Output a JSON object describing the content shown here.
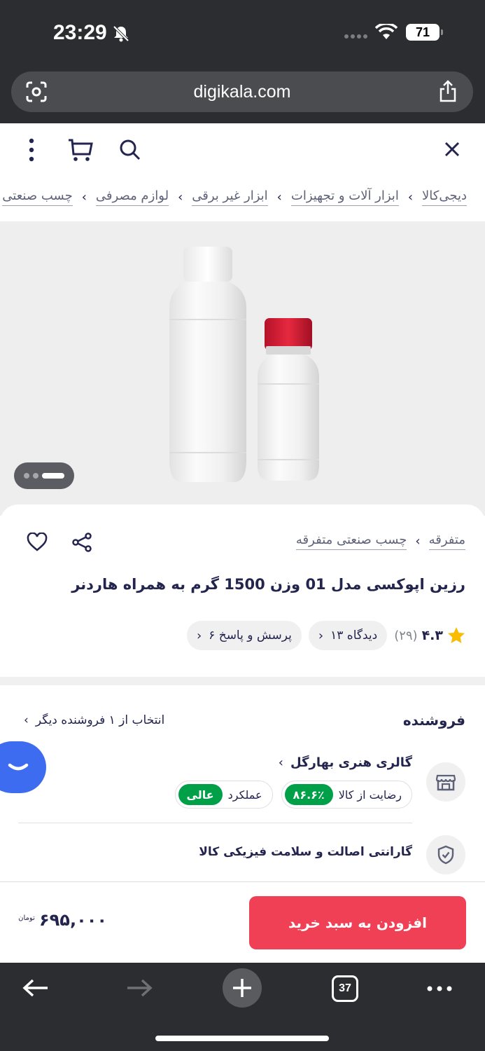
{
  "status": {
    "time": "23:29",
    "battery": "71"
  },
  "browser": {
    "url": "digikala.com",
    "tab_count": "37"
  },
  "breadcrumb": [
    "دیجی‌کالا",
    "ابزار آلات و تجهیزات",
    "ابزار غیر برقی",
    "لوازم مصرفی",
    "چسب صنعتی"
  ],
  "product": {
    "categories": [
      "متفرقه",
      "چسب صنعتی متفرقه"
    ],
    "title": "رزین اپوکسی مدل 01 وزن 1500 گرم به همراه هاردنر",
    "rating": "۴.۳",
    "rating_count": "(۲۹)",
    "comments": "۱۳ دیدگاه",
    "questions": "۶ پرسش و پاسخ"
  },
  "seller": {
    "heading": "فروشنده",
    "other_sellers": "انتخاب از ۱ فروشنده دیگر",
    "name": "گالری هنری بهارگل",
    "satisfaction_label": "رضایت از کالا",
    "satisfaction_value": "۸۶.۶٪",
    "performance_label": "عملکرد",
    "performance_value": "عالی",
    "guarantee": "گارانتی اصالت و سلامت فیزیکی کالا"
  },
  "buy": {
    "add_to_cart": "افزودن به سبد خرید",
    "price": "۶۹۵,۰۰۰",
    "currency": "تومان"
  },
  "colors": {
    "brand_red": "#ef4056",
    "success_green": "#00a049",
    "chrome_dark": "#2c2d30"
  }
}
